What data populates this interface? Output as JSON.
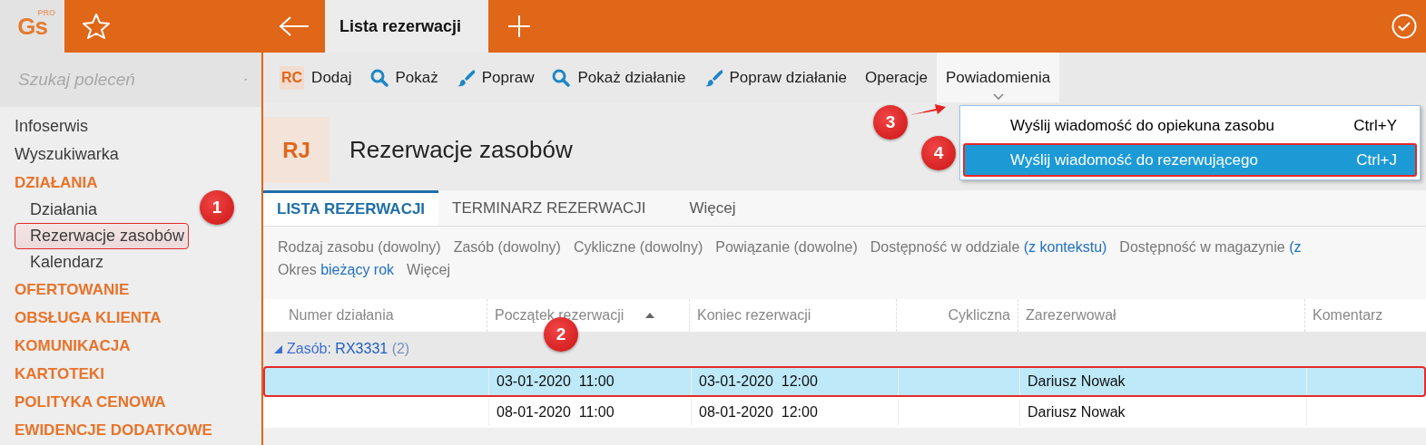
{
  "app": {
    "logo": "Gs",
    "logo_badge": "PRO"
  },
  "tabs": [
    {
      "label": "Lista rezerwacji",
      "selected": true
    }
  ],
  "sidebar": {
    "search_placeholder": "Szukaj poleceń",
    "items": [
      {
        "label": "Infoserwis",
        "kind": "link"
      },
      {
        "label": "Wyszukiwarka",
        "kind": "link"
      },
      {
        "label": "DZIAŁANIA",
        "kind": "section",
        "children": [
          {
            "label": "Działania",
            "highlighted": false
          },
          {
            "label": "Rezerwacje zasobów",
            "highlighted": true
          },
          {
            "label": "Kalendarz",
            "highlighted": false
          }
        ]
      },
      {
        "label": "OFERTOWANIE",
        "kind": "section"
      },
      {
        "label": "OBSŁUGA KLIENTA",
        "kind": "section"
      },
      {
        "label": "KOMUNIKACJA",
        "kind": "section"
      },
      {
        "label": "KARTOTEKI",
        "kind": "section"
      },
      {
        "label": "POLITYKA CENOWA",
        "kind": "section"
      },
      {
        "label": "EWIDENCJE DODATKOWE",
        "kind": "section"
      }
    ]
  },
  "toolbar": [
    {
      "label": "Dodaj",
      "kind": "badge",
      "icon_text": "RC",
      "expanded": false
    },
    {
      "label": "Pokaż",
      "kind": "search",
      "expanded": false
    },
    {
      "label": "Popraw",
      "kind": "edit",
      "expanded": false
    },
    {
      "label": "Pokaż działanie",
      "kind": "search",
      "expanded": false
    },
    {
      "label": "Popraw działanie",
      "kind": "edit",
      "expanded": false
    },
    {
      "label": "Operacje",
      "kind": "text",
      "expanded": false
    },
    {
      "label": "Powiadomienia",
      "kind": "text",
      "expanded": true
    }
  ],
  "menu": [
    {
      "label": "Wyślij wiadomość do opiekuna zasobu",
      "shortcut": "Ctrl+Y",
      "selected": false,
      "highlighted": false
    },
    {
      "label": "Wyślij wiadomość do rezerwującego",
      "shortcut": "Ctrl+J",
      "selected": true,
      "highlighted": true
    }
  ],
  "page": {
    "badge": "RJ",
    "title": "Rezerwacje zasobów"
  },
  "view_tabs": [
    {
      "label": "LISTA REZERWACJI",
      "selected": true
    },
    {
      "label": "TERMINARZ REZERWACJI",
      "selected": false
    },
    {
      "label": "Więcej",
      "selected": false
    }
  ],
  "filters": [
    [
      {
        "label": "Rodzaj zasobu",
        "value": "(dowolny)",
        "set": false
      },
      {
        "label": "Zasób",
        "value": "(dowolny)",
        "set": false
      },
      {
        "label": "Cykliczne",
        "value": "(dowolny)",
        "set": false
      },
      {
        "label": "Powiązanie",
        "value": "(dowolne)",
        "set": false
      },
      {
        "label": "Dostępność w oddziale",
        "value": "(z kontekstu)",
        "set": true
      },
      {
        "label": "Dostępność w magazynie",
        "value": "(z",
        "set": true
      }
    ],
    [
      {
        "label": "Okres",
        "value": "bieżący rok",
        "set": true
      },
      {
        "label": "Więcej"
      }
    ]
  ],
  "table": {
    "columns": [
      {
        "label": "Numer działania",
        "sorted": false
      },
      {
        "label": "Początek rezerwacji",
        "sorted": true
      },
      {
        "label": "Koniec rezerwacji",
        "sorted": false
      },
      {
        "label": "Cykliczna",
        "sorted": false
      },
      {
        "label": "Zarezerwował",
        "sorted": false
      },
      {
        "label": "Komentarz",
        "sorted": false
      }
    ],
    "group": {
      "label": "Zasób:",
      "value": "RX3331",
      "count": "(2)",
      "expanded": true
    },
    "rows": [
      {
        "start": "03-01-2020  11:00",
        "end": "03-01-2020  12:00",
        "reserved_by": "Dariusz Nowak",
        "selected": true,
        "highlighted": true
      },
      {
        "start": "08-01-2020  11:00",
        "end": "08-01-2020  12:00",
        "reserved_by": "Dariusz Nowak",
        "selected": false,
        "highlighted": false
      }
    ]
  },
  "callouts": [
    "1",
    "2",
    "3",
    "4"
  ]
}
